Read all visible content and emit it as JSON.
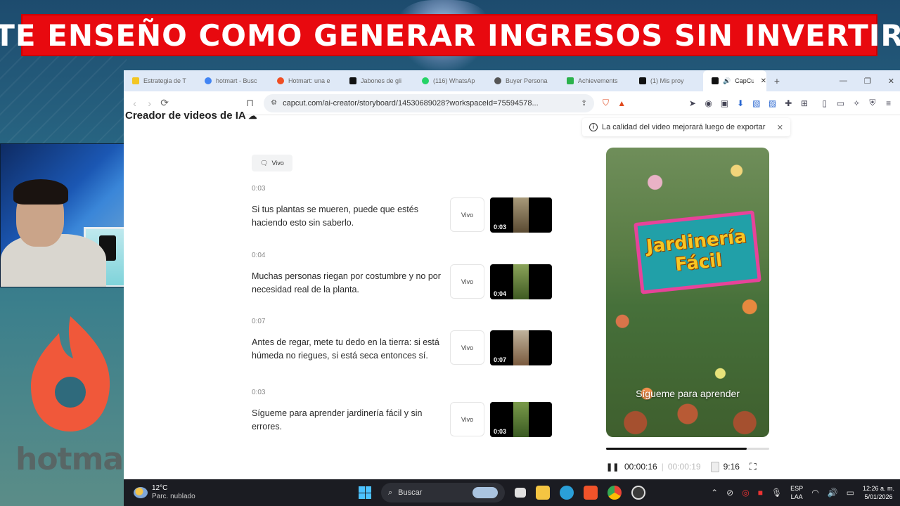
{
  "banner": {
    "text": "TE ENSEÑO COMO GENERAR INGRESOS SIN INVERTIR"
  },
  "hotmart": {
    "wordmark": "hotmart"
  },
  "browser": {
    "tabs": [
      {
        "title": "Estrategia de T",
        "favicon_color": "#f3c623"
      },
      {
        "title": "hotmart - Busc",
        "favicon_color": "#4285f4"
      },
      {
        "title": "Hotmart: una e",
        "favicon_color": "#f04e23"
      },
      {
        "title": "Jabones de gli",
        "favicon_color": "#111111"
      },
      {
        "title": "(116) WhatsAp",
        "favicon_color": "#25d366"
      },
      {
        "title": "Buyer Persona",
        "favicon_color": "#555555"
      },
      {
        "title": "Achievements",
        "favicon_color": "#2bb24c"
      },
      {
        "title": "(1) Mis proy",
        "favicon_color": "#111111"
      },
      {
        "title": "CapCut",
        "favicon_color": "#111111",
        "active": true
      }
    ],
    "new_tab": "+",
    "url": "capcut.com/ai-creator/storyboard/14530689028?workspaceId=75594578..."
  },
  "page": {
    "header": "Creador de videos de IA",
    "toast": "La calidad del video mejorará luego de exportar",
    "voice_label": "Vivo",
    "scenes": [
      {
        "time": "0:03",
        "text": "Si tus plantas se mueren, puede que estés haciendo esto sin saberlo.",
        "voice": "Vivo",
        "duration": "0:03",
        "thumb_color": "#7a6a4a"
      },
      {
        "time": "0:04",
        "text": "Muchas personas riegan por costumbre y no por necesidad real de la planta.",
        "voice": "Vivo",
        "duration": "0:04",
        "thumb_color": "#5f7a3a"
      },
      {
        "time": "0:07",
        "text": "Antes de regar, mete tu dedo en la tierra: si está húmeda no riegues, si está seca entonces sí.",
        "voice": "Vivo",
        "duration": "0:07",
        "thumb_color": "#8a7a64"
      },
      {
        "time": "0:03",
        "text": "Sígueme para aprender jardinería fácil y sin errores.",
        "voice": "Vivo",
        "duration": "0:03",
        "thumb_color": "#5a7a3a"
      }
    ],
    "preview": {
      "sign_line1": "Jardinería",
      "sign_line2": "Fácil",
      "caption": "Sígueme para aprender",
      "progress": 0.86,
      "current_time": "00:00:16",
      "total_time": "00:00:19",
      "ratio": "9:16"
    }
  },
  "taskbar": {
    "temp": "12°C",
    "weather": "Parc. nublado",
    "search_placeholder": "Buscar",
    "lang_line1": "ESP",
    "lang_line2": "LAA",
    "time": "12:26 a. m.",
    "date": "5/01/2026"
  }
}
